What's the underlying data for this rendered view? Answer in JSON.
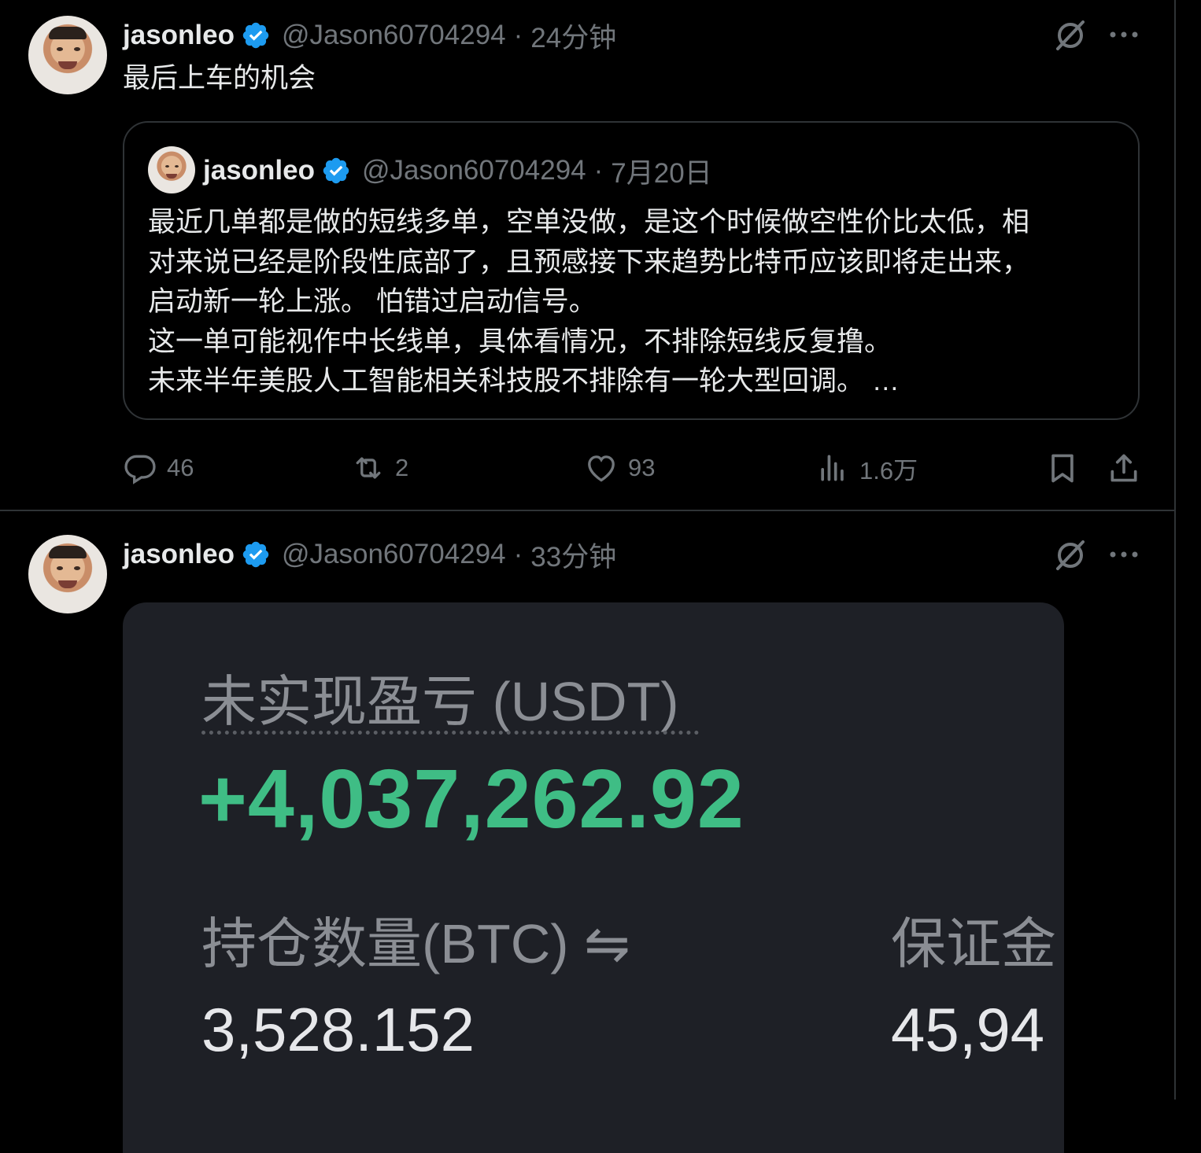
{
  "tweets": [
    {
      "author_name": "jasonleo",
      "handle": "@Jason60704294",
      "separator": "·",
      "time": "24分钟",
      "text": "最后上车的机会",
      "quote": {
        "author_name": "jasonleo",
        "handle": "@Jason60704294",
        "separator": "·",
        "time": "7月20日",
        "lines": [
          "最近几单都是做的短线多单，空单没做，是这个时候做空性价比太低，相",
          "对来说已经是阶段性底部了，且预感接下来趋势比特币应该即将走出来，",
          "启动新一轮上涨。 怕错过启动信号。",
          "这一单可能视作中长线单，具体看情况，不排除短线反复撸。",
          "未来半年美股人工智能相关科技股不排除有一轮大型回调。 …"
        ]
      },
      "actions": {
        "replies": "46",
        "retweets": "2",
        "likes": "93",
        "views": "1.6万"
      }
    },
    {
      "author_name": "jasonleo",
      "handle": "@Jason60704294",
      "separator": "·",
      "time": "33分钟",
      "media": {
        "pnl_label": "未实现盈亏 (USDT)",
        "pnl_value": "+4,037,262.92",
        "position_label": "持仓数量(BTC) ⇋",
        "position_value": "3,528.152",
        "margin_label": "保证金",
        "margin_value": "45,94"
      }
    }
  ],
  "icons": {
    "verified": "verified-badge-icon",
    "grok": "grok-icon",
    "more": "more-icon",
    "reply": "reply-icon",
    "retweet": "retweet-icon",
    "like": "heart-icon",
    "views": "views-icon",
    "bookmark": "bookmark-icon",
    "share": "share-icon"
  },
  "colors": {
    "background": "#000000",
    "text": "#e7e9ea",
    "muted": "#71767b",
    "verified": "#1d9bf0",
    "profit": "#3fbd85"
  }
}
